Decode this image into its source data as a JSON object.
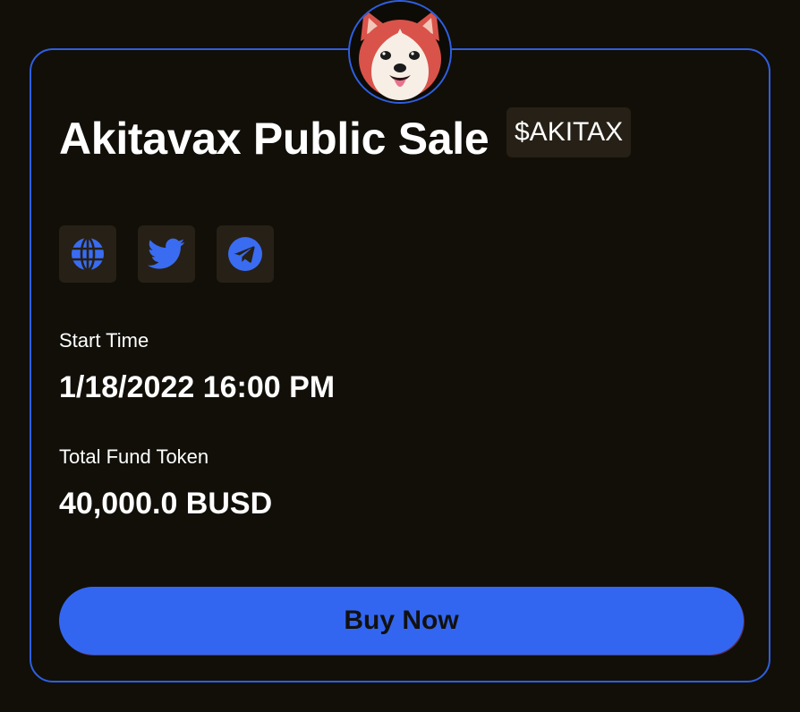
{
  "sale": {
    "title": "Akitavax Public Sale",
    "ticker": "$AKITAX",
    "avatar_icon": "akita-dog-logo",
    "socials": [
      {
        "name": "globe-icon",
        "label": "Website"
      },
      {
        "name": "twitter-icon",
        "label": "Twitter"
      },
      {
        "name": "telegram-icon",
        "label": "Telegram"
      }
    ],
    "start_time_label": "Start Time",
    "start_time_value": "1/18/2022 16:00 PM",
    "total_fund_label": "Total Fund Token",
    "total_fund_value": "40,000.0 BUSD",
    "buy_label": "Buy Now"
  },
  "colors": {
    "background": "#110f08",
    "accent": "#3366f0",
    "border": "#2f5fe0",
    "chip": "#262016",
    "icon": "#3a6cf2"
  }
}
